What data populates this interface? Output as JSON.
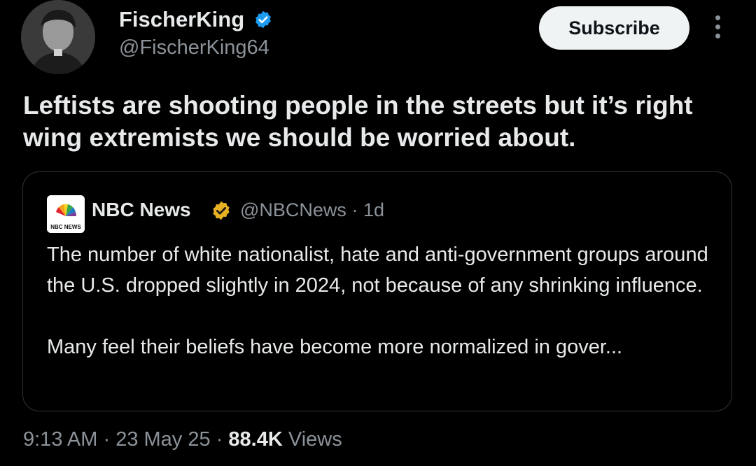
{
  "author": {
    "name": "FischerKing",
    "handle": "@FischerKing64",
    "verified_color": "#1d9bf0"
  },
  "actions": {
    "subscribe_label": "Subscribe"
  },
  "tweet": {
    "text": "Leftists are shooting people in the streets but it’s right wing extremists we should be worried about."
  },
  "quote": {
    "logo_text": "NBC NEWS",
    "name": "NBC News",
    "verified_color": "#e8b124",
    "handle": "@NBCNews",
    "separator": "·",
    "age": "1d",
    "paragraph_1": "The number of white nationalist, hate and anti-government groups around the U.S. dropped slightly in 2024, not because of any shrinking influence.",
    "paragraph_2": "Many feel their beliefs have become more normalized in gover..."
  },
  "meta": {
    "time": "9:13 AM",
    "sep1": "·",
    "date": "23 May 25",
    "sep2": "·",
    "views_count": "88.4K",
    "views_label": "Views"
  }
}
